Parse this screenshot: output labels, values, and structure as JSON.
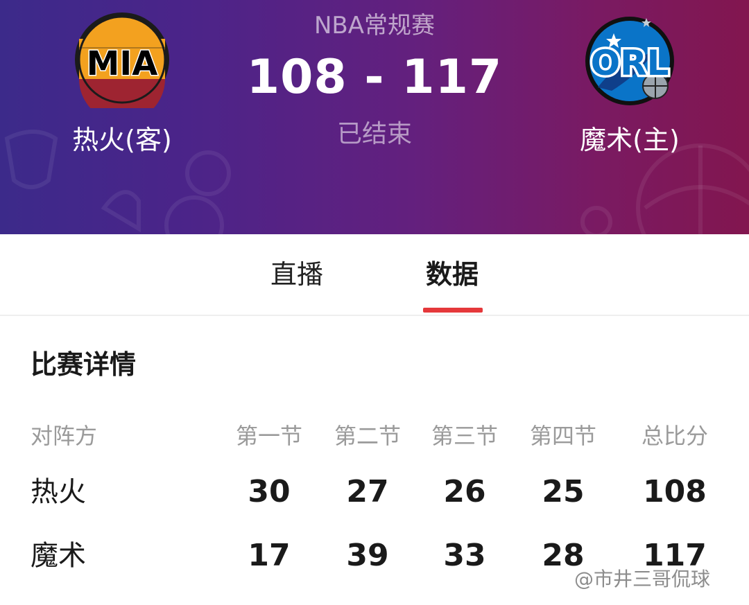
{
  "header": {
    "league": "NBA常规赛",
    "score": "108 - 117",
    "status": "已结束",
    "away_team": {
      "abbr": "MIA",
      "name": "热火(客)"
    },
    "home_team": {
      "abbr": "ORL",
      "name": "魔术(主)"
    }
  },
  "tabs": [
    {
      "label": "直播",
      "active": false
    },
    {
      "label": "数据",
      "active": true
    }
  ],
  "details": {
    "title": "比赛详情",
    "columns": [
      "对阵方",
      "第一节",
      "第二节",
      "第三节",
      "第四节",
      "总比分"
    ],
    "rows": [
      {
        "team": "热火",
        "q1": "30",
        "q2": "27",
        "q3": "26",
        "q4": "25",
        "total": "108"
      },
      {
        "team": "魔术",
        "q1": "17",
        "q2": "39",
        "q3": "33",
        "q4": "28",
        "total": "117"
      }
    ]
  },
  "watermark": "@市井三哥侃球",
  "colors": {
    "header_left": "#3c2a8a",
    "header_right": "#82164f",
    "tab_indicator": "#e5383b",
    "mia_red": "#c8102e",
    "mia_orange": "#f9a01b",
    "orl_blue": "#0077c0"
  }
}
